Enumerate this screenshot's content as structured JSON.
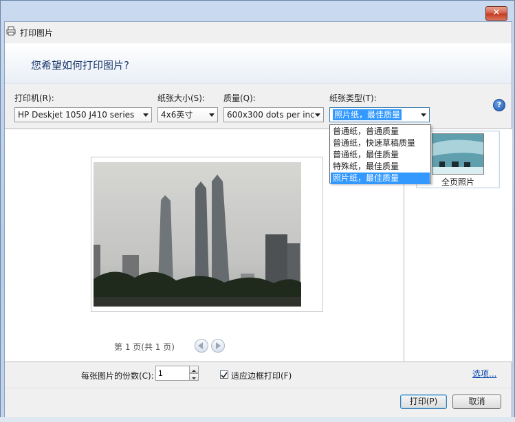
{
  "window": {
    "title": "打印图片",
    "close_glyph": "✕"
  },
  "header": {
    "question": "您希望如何打印图片?"
  },
  "settings": {
    "printer": {
      "label": "打印机(R):",
      "value": "HP Deskjet 1050 J410 series"
    },
    "paper_size": {
      "label": "纸张大小(S):",
      "value": "4x6英寸"
    },
    "quality": {
      "label": "质量(Q):",
      "value": "600x300 dots per inc"
    },
    "paper_type": {
      "label": "纸张类型(T):",
      "value": "照片纸，最佳质量",
      "options": [
        "普通纸，普通质量",
        "普通纸，快速草稿质量",
        "普通纸，最佳质量",
        "特殊纸，最佳质量",
        "照片纸，最佳质量"
      ],
      "selected_index": 4
    }
  },
  "help": {
    "glyph": "?"
  },
  "preview": {
    "page_info": "第 1 页(共 1 页)"
  },
  "layouts": [
    {
      "label": "全页照片"
    }
  ],
  "copies": {
    "label": "每张图片的份数(C):",
    "value": "1"
  },
  "fit_frame": {
    "label": "适应边框打印(F)",
    "checked": true,
    "check_glyph": "✓"
  },
  "options_link": "选项...",
  "buttons": {
    "print": "打印(P)",
    "cancel": "取消"
  },
  "colors": {
    "selection": "#3399ff",
    "link": "#0645ad",
    "title_text": "#1c3a70"
  }
}
